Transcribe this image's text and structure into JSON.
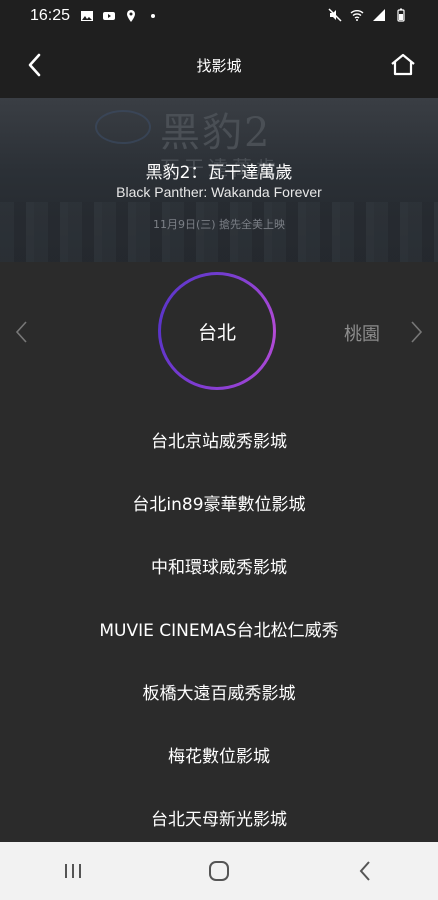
{
  "status_bar": {
    "time": "16:25"
  },
  "header": {
    "title": "找影城"
  },
  "banner": {
    "bg_title": "黑豹2",
    "bg_subtitle": "瓦干達萬歲",
    "release_text": "11月9日(三) 搶先全美上映",
    "movie_title_zh": "黑豹2：瓦干達萬歲",
    "movie_title_en": "Black Panther: Wakanda Forever"
  },
  "city_selector": {
    "current_city": "台北",
    "next_city": "桃園"
  },
  "theaters": [
    "台北京站威秀影城",
    "台北in89豪華數位影城",
    "中和環球威秀影城",
    "MUVIE CINEMAS台北松仁威秀",
    "板橋大遠百威秀影城",
    "梅花數位影城",
    "台北天母新光影城"
  ],
  "colors": {
    "background": "#2b2b2b",
    "header": "#1f1f1f",
    "ring_accent": "#8a3fd4",
    "nav_bar": "#f2f2f2"
  }
}
